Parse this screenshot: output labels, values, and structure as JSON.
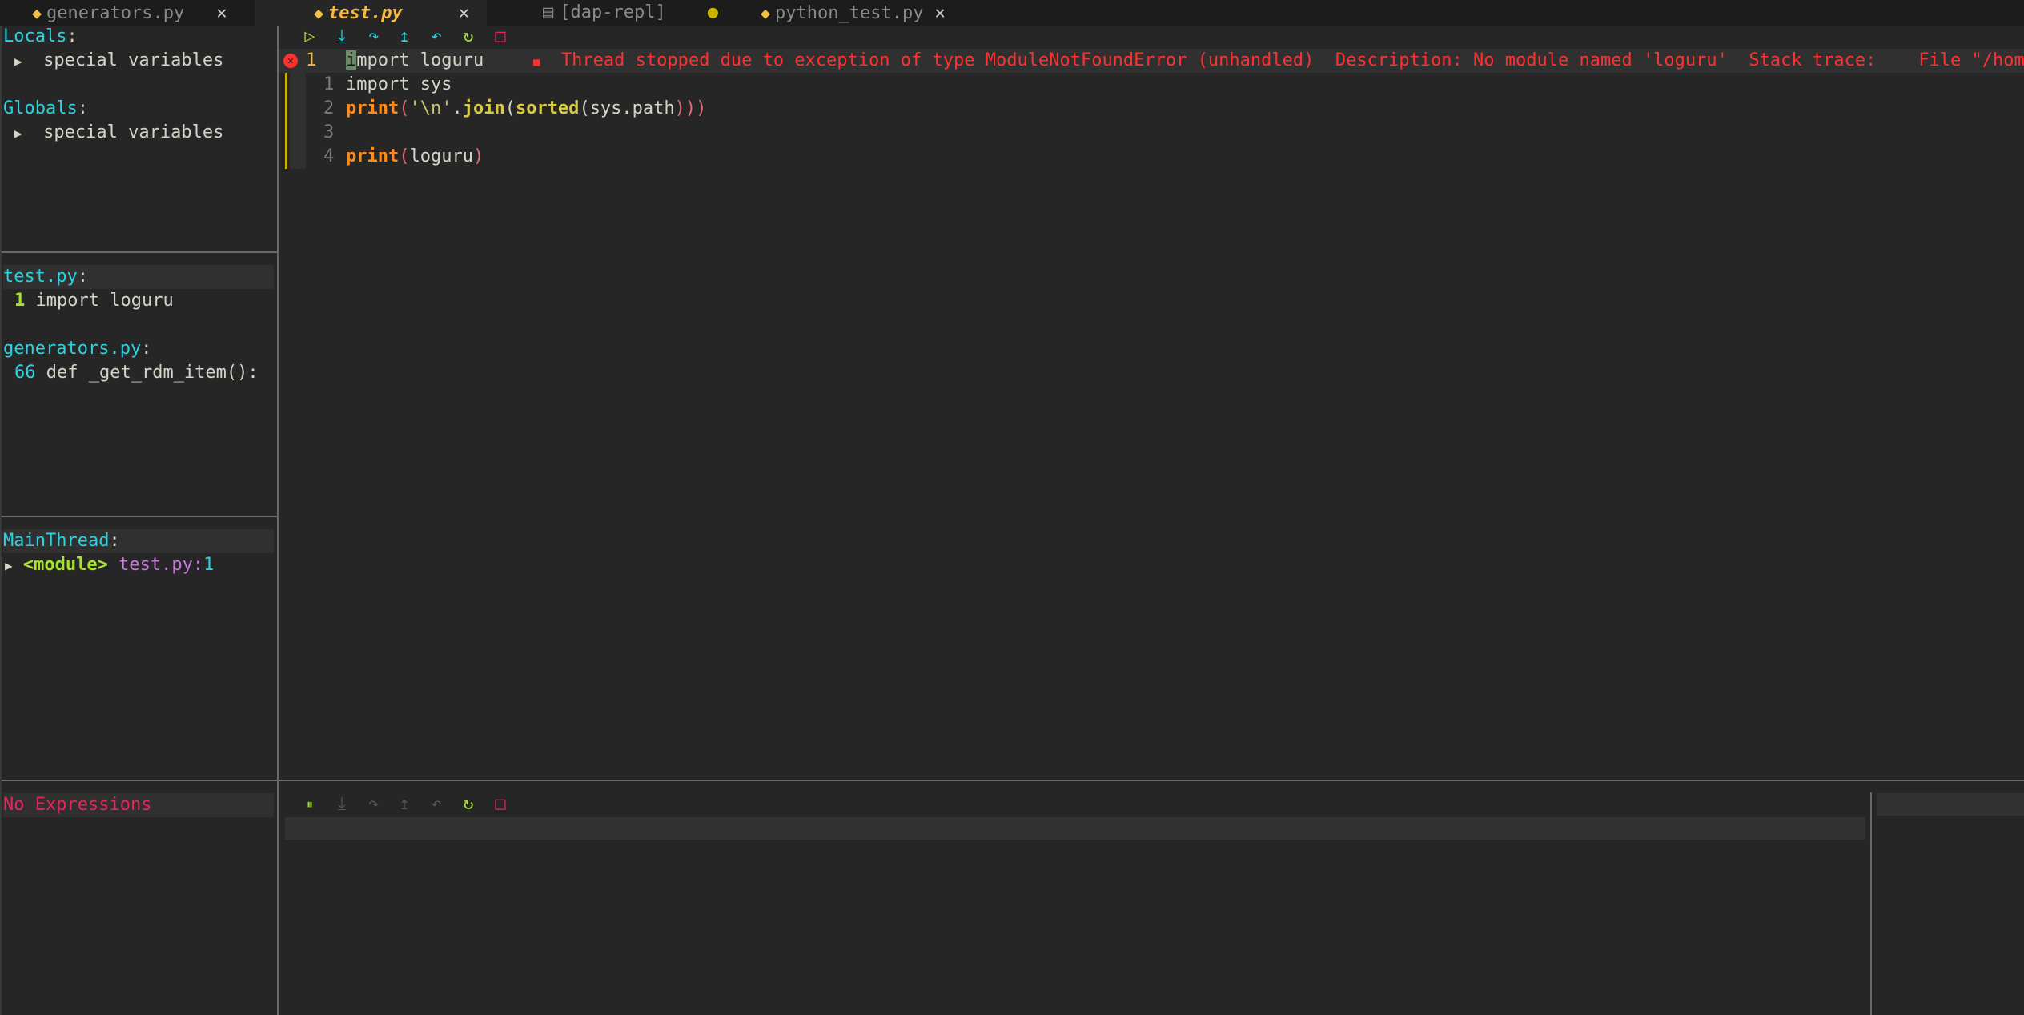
{
  "tabs": [
    {
      "label": "generators.py",
      "close": "✕"
    },
    {
      "label": "test.py",
      "close": "✕"
    },
    {
      "label": "[dap-repl]",
      "modified": "●"
    },
    {
      "label": "python_test.py",
      "close": "✕"
    }
  ],
  "scopes": {
    "locals_header": "Locals",
    "locals_item": "special variables",
    "globals_header": "Globals",
    "globals_item": "special variables",
    "colon": ":"
  },
  "breakpoints": {
    "file1": "test.py",
    "file1_line": "1",
    "file1_code": "import loguru",
    "file2": "generators.py",
    "file2_line": "66",
    "file2_code": "def _get_rdm_item():",
    "colon": ":"
  },
  "threads": {
    "name": "MainThread",
    "frame_name": "<module>",
    "frame_file": "test.py",
    "frame_line": "1",
    "colon": ":"
  },
  "watches": {
    "empty_text": "No Expressions"
  },
  "editor": {
    "lines": [
      {
        "num": "1",
        "code_prefix": "i",
        "code_rest": "mport loguru"
      },
      {
        "num": "1",
        "code": "import sys"
      },
      {
        "num": "2",
        "fn": "print",
        "open": "(",
        "str": "'\\n'",
        "dot": ".",
        "method": "join",
        "open2": "(",
        "fn2": "sorted",
        "open3": "(",
        "arg": "sys.path",
        "close": ")))"
      },
      {
        "num": "3",
        "code": ""
      },
      {
        "num": "4",
        "fn": "print",
        "open": "(",
        "arg": "loguru",
        "close": ")"
      }
    ],
    "diagnostic_marker": "■",
    "diagnostic": "Thread stopped due to exception of type ModuleNotFoundError (unhandled)  Description: No module named 'loguru'  Stack trace:    File \"/home/u"
  },
  "toolbar": {
    "continue": "▷",
    "step_into": "⤓",
    "step_over": "↷",
    "step_out": "↥",
    "step_back": "↶",
    "restart": "↻",
    "stop": "□",
    "pause": "⏸"
  },
  "colors": {
    "accent_cyan": "#2ad2e2",
    "error_red": "#ff3030",
    "tab_active": "#f6b93b"
  }
}
